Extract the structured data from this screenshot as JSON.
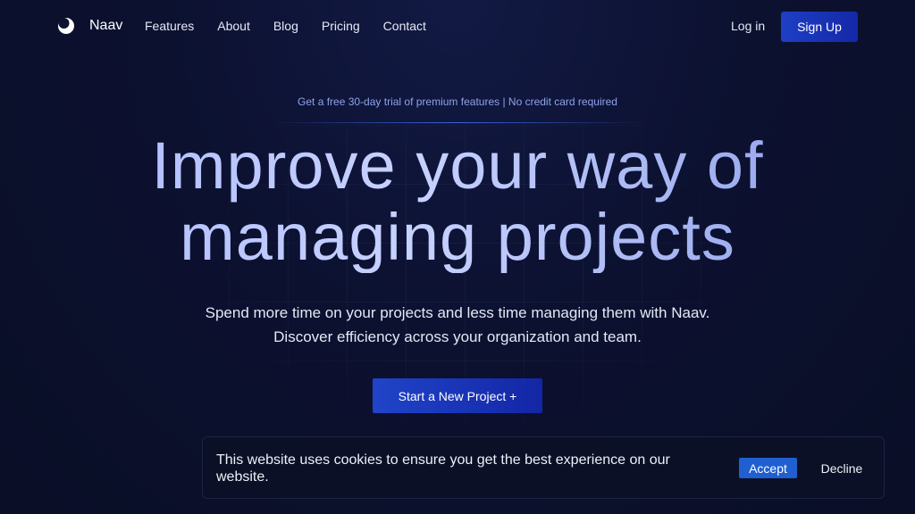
{
  "nav": {
    "brand": "Naav",
    "brand_icon": "moon-icon",
    "links": [
      "Features",
      "About",
      "Blog",
      "Pricing",
      "Contact"
    ],
    "login_label": "Log in",
    "signup_label": "Sign Up"
  },
  "hero": {
    "trial_text": "Get a free 30-day trial of premium features | No credit card required",
    "headline_line1": "Improve your way of",
    "headline_line2": "managing projects",
    "sub_line1": "Spend more time on your projects and less time managing them with Naav.",
    "sub_line2": "Discover efficiency across your organization and team.",
    "cta_label": "Start a New Project +"
  },
  "cookie": {
    "message": "This website uses cookies to ensure you get the best experience on our website.",
    "accept_label": "Accept",
    "decline_label": "Decline"
  },
  "colors": {
    "background": "#0b1029",
    "accent": "#1e3fc4",
    "accept": "#1f5fd0"
  }
}
